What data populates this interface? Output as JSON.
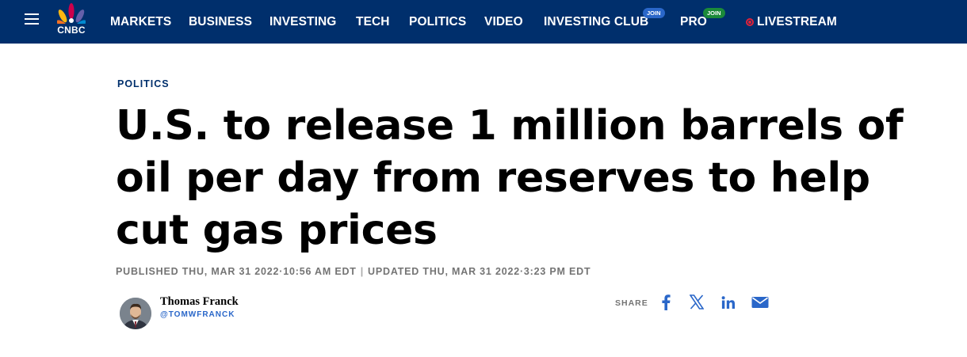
{
  "nav": {
    "logo_text": "CNBC",
    "items": [
      {
        "label": "MARKETS"
      },
      {
        "label": "BUSINESS"
      },
      {
        "label": "INVESTING"
      },
      {
        "label": "TECH"
      },
      {
        "label": "POLITICS"
      },
      {
        "label": "VIDEO"
      },
      {
        "label": "INVESTING CLUB",
        "badge": "JOIN"
      },
      {
        "label": "PRO",
        "badge": "JOIN"
      },
      {
        "label": "LIVESTREAM"
      }
    ]
  },
  "article": {
    "section": "POLITICS",
    "headline": "U.S. to release 1 million barrels of oil per day from reserves to help cut gas prices",
    "published": "PUBLISHED THU, MAR 31 2022·10:56 AM EDT",
    "separator": "|",
    "updated": "UPDATED THU, MAR 31 2022·3:23 PM EDT",
    "author": {
      "name": "Thomas Franck",
      "handle": "@TOMWFRANCK"
    },
    "share": {
      "label": "SHARE",
      "icons": [
        "facebook-icon",
        "x-icon",
        "linkedin-icon",
        "email-icon"
      ]
    }
  },
  "colors": {
    "nav_bg": "#002f6c",
    "link_blue": "#2a67c9",
    "live_red": "#e0223a",
    "meta_gray": "#747474"
  }
}
